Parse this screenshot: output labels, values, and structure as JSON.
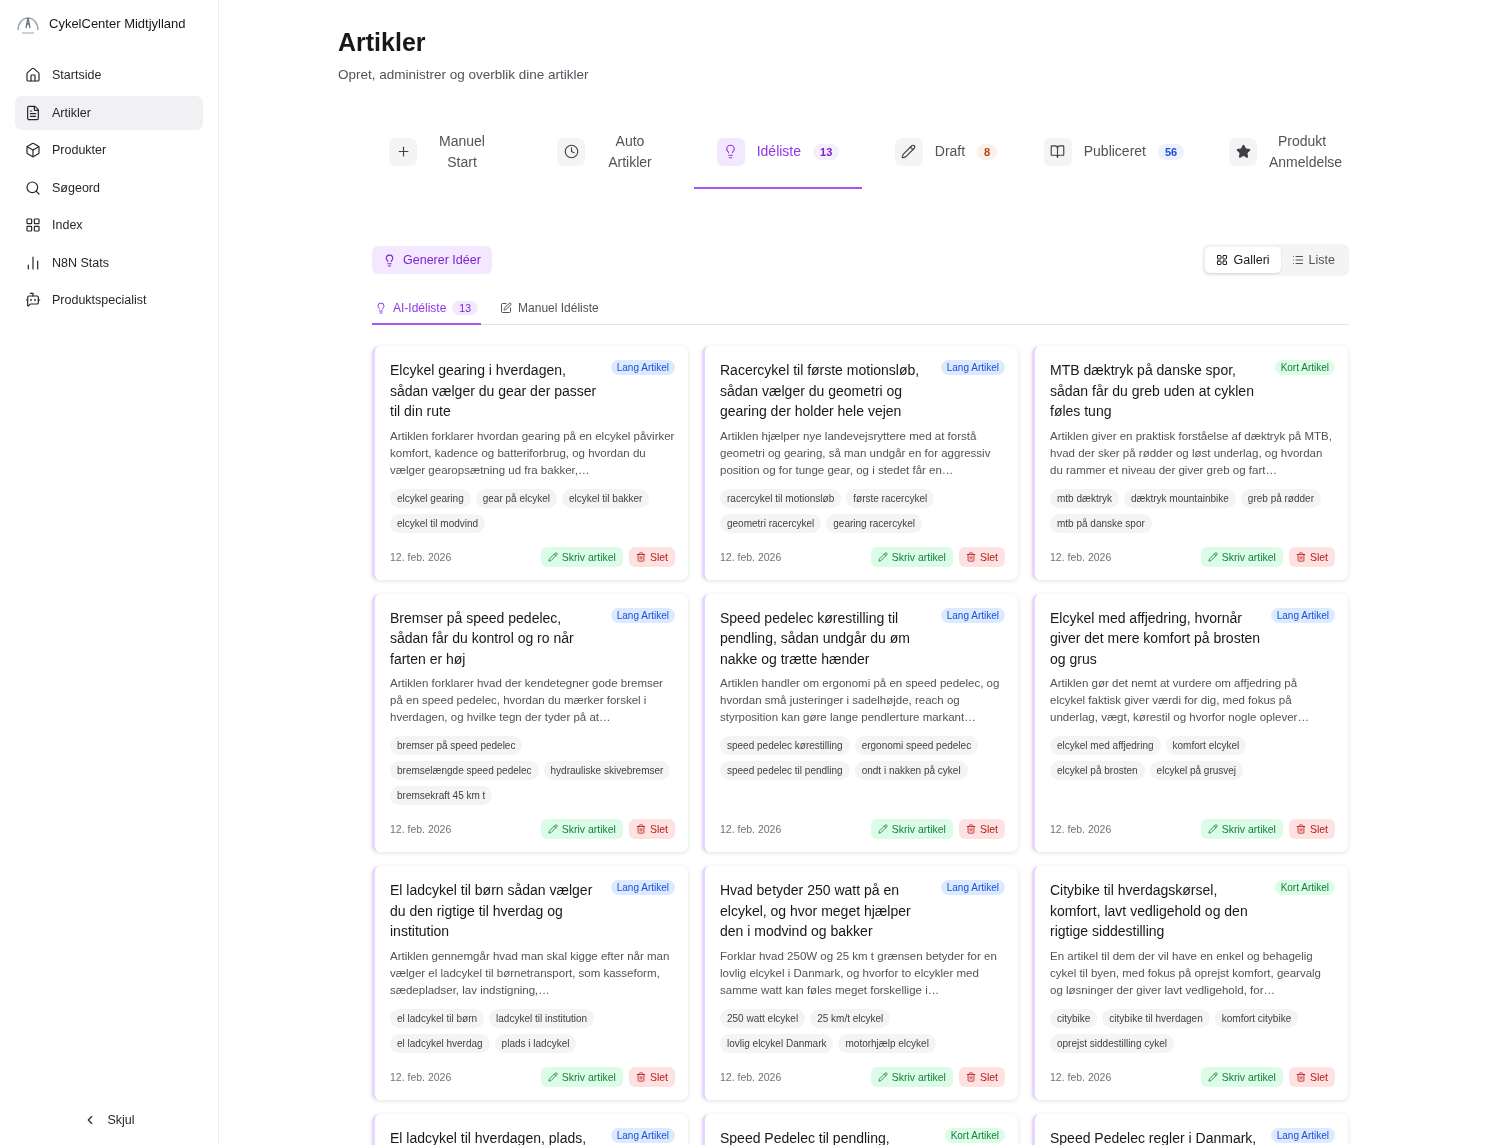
{
  "sidebar": {
    "brand": "CykelCenter Midtjylland",
    "items": [
      {
        "label": "Startside",
        "selected": false
      },
      {
        "label": "Artikler",
        "selected": true
      },
      {
        "label": "Produkter",
        "selected": false
      },
      {
        "label": "Søgeord",
        "selected": false
      },
      {
        "label": "Index",
        "selected": false
      },
      {
        "label": "N8N Stats",
        "selected": false
      },
      {
        "label": "Produktspecialist",
        "selected": false
      }
    ],
    "collapse": "Skjul"
  },
  "header": {
    "title": "Artikler",
    "subtitle": "Opret, administrer og overblik dine artikler"
  },
  "tabs": [
    {
      "label": "Manuel Start",
      "selected": false
    },
    {
      "label": "Auto Artikler",
      "selected": false
    },
    {
      "label": "Idéliste",
      "count": "13",
      "color": "#7e22ce",
      "selected": true
    },
    {
      "label": "Draft",
      "count": "8",
      "color": "#c2410c",
      "selected": false
    },
    {
      "label": "Publiceret",
      "count": "56",
      "color": "#1d4ed8",
      "selected": false
    },
    {
      "label": "Produkt Anmeldelse",
      "selected": false
    }
  ],
  "generate_button": "Generer Idéer",
  "view_toggle": [
    {
      "label": "Galleri",
      "selected": true
    },
    {
      "label": "Liste",
      "selected": false
    }
  ],
  "subtabs": [
    {
      "label": "AI-Idéliste",
      "count": "13",
      "selected": true
    },
    {
      "label": "Manuel Idéliste",
      "selected": false
    }
  ],
  "cards": [
    {
      "title": "Elcykel gearing i hverdagen, sådan vælger du gear der passer til din rute",
      "tag": {
        "label": "Lang Artikel",
        "kind": "long"
      },
      "description": "Artiklen forklarer hvordan gearing på en elcykel påvirker komfort, kadence og batteriforbrug, og hvordan du vælger gearopsætning ud fra bakker,…",
      "keywords": [
        "elcykel gearing",
        "gear på elcykel",
        "elcykel til bakker",
        "elcykel til modvind"
      ],
      "date": "12. feb. 2026",
      "write": "Skriv artikel",
      "delete": "Slet"
    },
    {
      "title": "Racercykel til første motionsløb, sådan vælger du geometri og gearing der holder hele vejen",
      "tag": {
        "label": "Lang Artikel",
        "kind": "long"
      },
      "description": "Artiklen hjælper nye landevejsryttere med at forstå geometri og gearing, så man undgår en for aggressiv position og for tunge gear, og i stedet får en…",
      "keywords": [
        "racercykel til motionsløb",
        "første racercykel",
        "geometri racercykel",
        "gearing racercykel"
      ],
      "date": "12. feb. 2026",
      "write": "Skriv artikel",
      "delete": "Slet"
    },
    {
      "title": "MTB dæktryk på danske spor, sådan får du greb uden at cyklen føles tung",
      "tag": {
        "label": "Kort Artikel",
        "kind": "short"
      },
      "description": "Artiklen giver en praktisk forståelse af dæktryk på MTB, hvad der sker på rødder og løst underlag, og hvordan du rammer et niveau der giver greb og fart…",
      "keywords": [
        "mtb dæktryk",
        "dæktryk mountainbike",
        "greb på rødder",
        "mtb på danske spor"
      ],
      "date": "12. feb. 2026",
      "write": "Skriv artikel",
      "delete": "Slet"
    },
    {
      "title": "Bremser på speed pedelec, sådan får du kontrol og ro når farten er høj",
      "tag": {
        "label": "Lang Artikel",
        "kind": "long"
      },
      "description": "Artiklen forklarer hvad der kendetegner gode bremser på en speed pedelec, hvordan du mærker forskel i hverdagen, og hvilke tegn der tyder på at…",
      "keywords": [
        "bremser på speed pedelec",
        "bremselængde speed pedelec",
        "hydrauliske skivebremser",
        "bremsekraft 45 km t"
      ],
      "date": "12. feb. 2026",
      "write": "Skriv artikel",
      "delete": "Slet"
    },
    {
      "title": "Speed pedelec kørestilling til pendling, sådan undgår du øm nakke og trætte hænder",
      "tag": {
        "label": "Lang Artikel",
        "kind": "long"
      },
      "description": "Artiklen handler om ergonomi på en speed pedelec, og hvordan små justeringer i sadelhøjde, reach og styrposition kan gøre lange pendlerture markant…",
      "keywords": [
        "speed pedelec kørestilling",
        "ergonomi speed pedelec",
        "speed pedelec til pendling",
        "ondt i nakken på cykel"
      ],
      "date": "12. feb. 2026",
      "write": "Skriv artikel",
      "delete": "Slet"
    },
    {
      "title": "Elcykel med affjedring, hvornår giver det mere komfort på brosten og grus",
      "tag": {
        "label": "Lang Artikel",
        "kind": "long"
      },
      "description": "Artiklen gør det nemt at vurdere om affjedring på elcykel faktisk giver værdi for dig, med fokus på underlag, vægt, kørestil og hvorfor nogle oplever…",
      "keywords": [
        "elcykel med affjedring",
        "komfort elcykel",
        "elcykel på brosten",
        "elcykel på grusvej"
      ],
      "date": "12. feb. 2026",
      "write": "Skriv artikel",
      "delete": "Slet"
    },
    {
      "title": "El ladcykel til børn sådan vælger du den rigtige til hverdag og institution",
      "tag": {
        "label": "Lang Artikel",
        "kind": "long"
      },
      "description": "Artiklen gennemgår hvad man skal kigge efter når man vælger el ladcykel til børnetransport, som kasseform, sædepladser, lav indstigning,…",
      "keywords": [
        "el ladcykel til børn",
        "ladcykel til institution",
        "el ladcykel hverdag",
        "plads i ladcykel"
      ],
      "date": "12. feb. 2026",
      "write": "Skriv artikel",
      "delete": "Slet"
    },
    {
      "title": "Hvad betyder 250 watt på en elcykel, og hvor meget hjælper den i modvind og bakker",
      "tag": {
        "label": "Lang Artikel",
        "kind": "long"
      },
      "description": "Forklar hvad 250W og 25 km t grænsen betyder for en lovlig elcykel i Danmark, og hvorfor to elcykler med samme watt kan føles meget forskellige i…",
      "keywords": [
        "250 watt elcykel",
        "25 km/t elcykel",
        "lovlig elcykel Danmark",
        "motorhjælp elcykel"
      ],
      "date": "12. feb. 2026",
      "write": "Skriv artikel",
      "delete": "Slet"
    },
    {
      "title": "Citybike til hverdagskørsel, komfort, lavt vedligehold og den rigtige siddestilling",
      "tag": {
        "label": "Kort Artikel",
        "kind": "short"
      },
      "description": "En artikel til dem der vil have en enkel og behagelig cykel til byen, med fokus på oprejst komfort, gearvalg og løsninger der giver lavt vedligehold, for…",
      "keywords": [
        "citybike",
        "citybike til hverdagen",
        "komfort citybike",
        "oprejst siddestilling cykel"
      ],
      "date": "12. feb. 2026",
      "write": "Skriv artikel",
      "delete": "Slet"
    },
    {
      "title": "El ladcykel til hverdagen, plads,",
      "tag": {
        "label": "Lang Artikel",
        "kind": "long"
      }
    },
    {
      "title": "Speed Pedelec til pendling,",
      "tag": {
        "label": "Kort Artikel",
        "kind": "short"
      }
    },
    {
      "title": "Speed Pedelec regler i Danmark,",
      "tag": {
        "label": "Lang Artikel",
        "kind": "long"
      }
    }
  ]
}
